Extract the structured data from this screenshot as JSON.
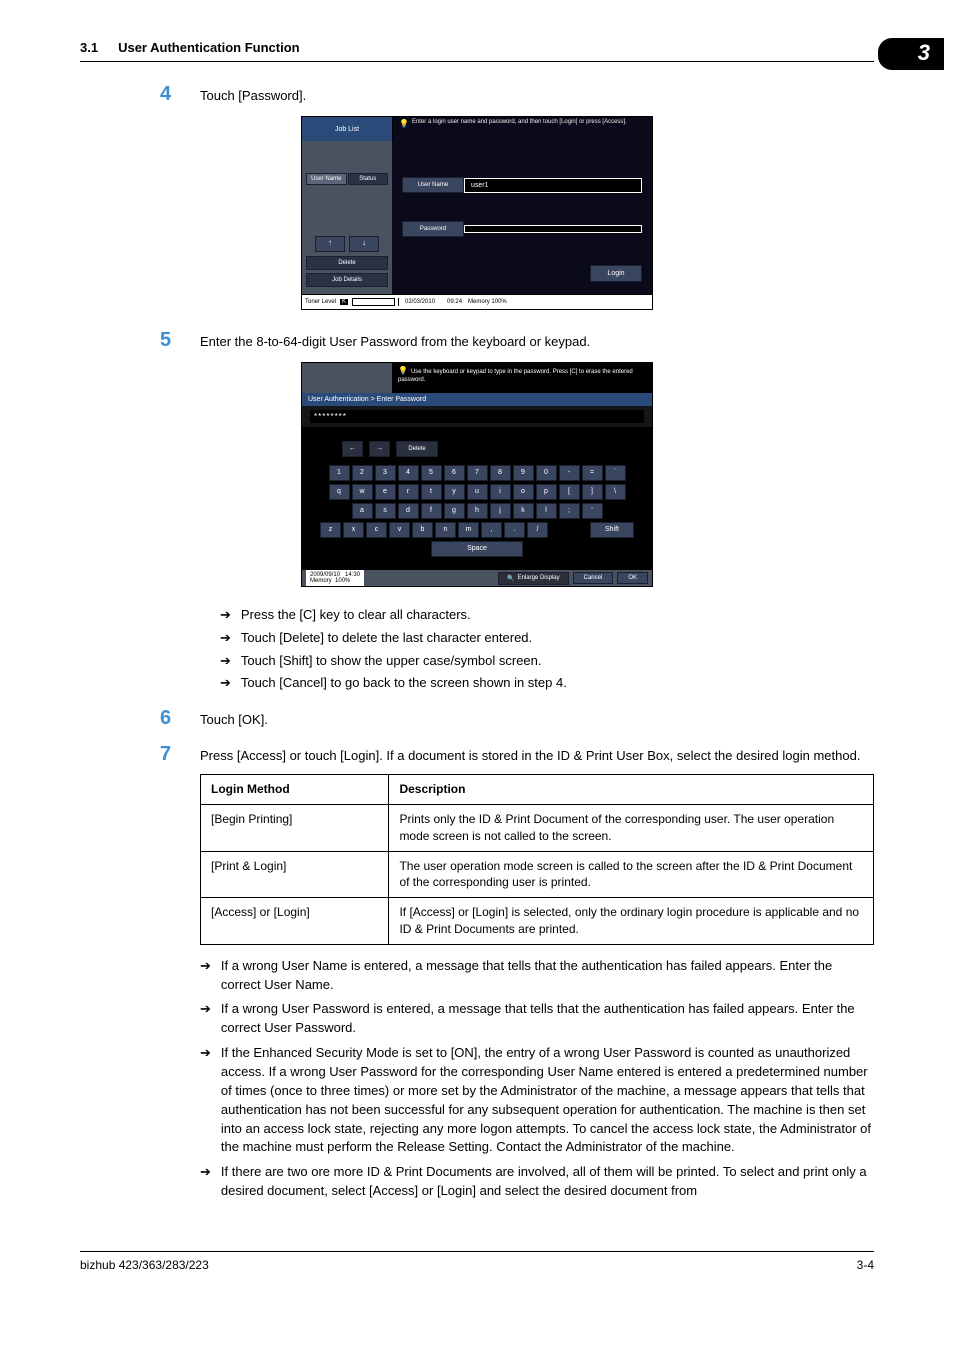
{
  "header": {
    "section_no": "3.1",
    "section_title": "User Authentication Function",
    "chapter_badge": "3"
  },
  "steps": {
    "s4": {
      "num": "4",
      "text": "Touch [Password]."
    },
    "s5": {
      "num": "5",
      "text": "Enter the 8-to-64-digit User Password from the keyboard or keypad."
    },
    "s6": {
      "num": "6",
      "text": "Touch [OK]."
    },
    "s7": {
      "num": "7",
      "text": "Press [Access] or touch [Login]. If a document is stored in the ID & Print User Box, select the desired login method."
    }
  },
  "bullets_after5": [
    "Press the [C] key to clear all characters.",
    "Touch [Delete] to delete the last character entered.",
    "Touch [Shift] to show the upper case/symbol screen.",
    "Touch [Cancel] to go back to the screen shown in step 4."
  ],
  "login_ss": {
    "job_list": "Job List",
    "hint": "Enter a login user name and password, and then touch [Login] or press [Access].",
    "tab_user": "User Name",
    "tab_status": "Status",
    "delete_btn": "Delete",
    "job_details_btn": "Job Details",
    "user_name_label": "User Name",
    "user_name_value": "user1",
    "password_label": "Password",
    "password_value": "",
    "login_btn": "Login",
    "toner_label": "Toner Level",
    "toner_k": "K",
    "date": "02/03/2010",
    "time": "09:24",
    "memory_label": "Memory",
    "memory_value": "100%"
  },
  "kb_ss": {
    "hint": "Use the keyboard or keypad to type in the password.\nPress [C] to erase the entered password.",
    "breadcrumb": "User Authentication > Enter Password",
    "input_value": "********",
    "arrow_left": "←",
    "arrow_right": "→",
    "delete_key": "Delete",
    "row1": [
      "1",
      "2",
      "3",
      "4",
      "5",
      "6",
      "7",
      "8",
      "9",
      "0",
      "-",
      "=",
      "`"
    ],
    "row2": [
      "q",
      "w",
      "e",
      "r",
      "t",
      "y",
      "u",
      "i",
      "o",
      "p",
      "[",
      "]",
      "\\"
    ],
    "row3": [
      "a",
      "s",
      "d",
      "f",
      "g",
      "h",
      "j",
      "k",
      "l",
      ";",
      "'"
    ],
    "row4": [
      "z",
      "x",
      "c",
      "v",
      "b",
      "n",
      "m",
      ",",
      ".",
      "/"
    ],
    "shift_key": "Shift",
    "space_key": "Space",
    "date": "2009/09/10",
    "time": "14:30",
    "memory_label": "Memory",
    "memory_value": "100%",
    "enlarge_label": "Enlarge Display",
    "cancel_btn": "Cancel",
    "ok_btn": "OK"
  },
  "table": {
    "h1": "Login Method",
    "h2": "Description",
    "rows": [
      {
        "method": "[Begin Printing]",
        "desc": "Prints only the ID & Print Document of the corresponding user. The user operation mode screen is not called to the screen."
      },
      {
        "method": "[Print & Login]",
        "desc": "The user operation mode screen is called to the screen after the ID & Print Document of the corresponding user is printed."
      },
      {
        "method": "[Access] or [Login]",
        "desc": "If [Access] or [Login] is selected, only the ordinary login procedure is applicable and no ID & Print Documents are printed."
      }
    ]
  },
  "bullets_after_table": [
    "If a wrong User Name is entered, a message that tells that the authentication has failed appears. Enter the correct User Name.",
    "If a wrong User Password is entered, a message that tells that the authentication has failed appears. Enter the correct User Password.",
    "If the Enhanced Security Mode is set to [ON], the entry of a wrong User Password is counted as unauthorized access. If a wrong User Password for the corresponding User Name entered is entered a predetermined number of times (once to three times) or more set by the Administrator of the machine, a message appears that tells that authentication has not been successful for any subsequent operation for authentication. The machine is then set into an access lock state, rejecting any more logon attempts. To cancel the access lock state, the Administrator of the machine must perform the Release Setting. Contact the Administrator of the machine.",
    "If there are two ore more ID & Print Documents are involved, all of them will be printed. To select and print only a desired document, select [Access] or [Login] and select the desired document from"
  ],
  "footer": {
    "left": "bizhub 423/363/283/223",
    "right": "3-4"
  },
  "arrow_glyph": "➔"
}
